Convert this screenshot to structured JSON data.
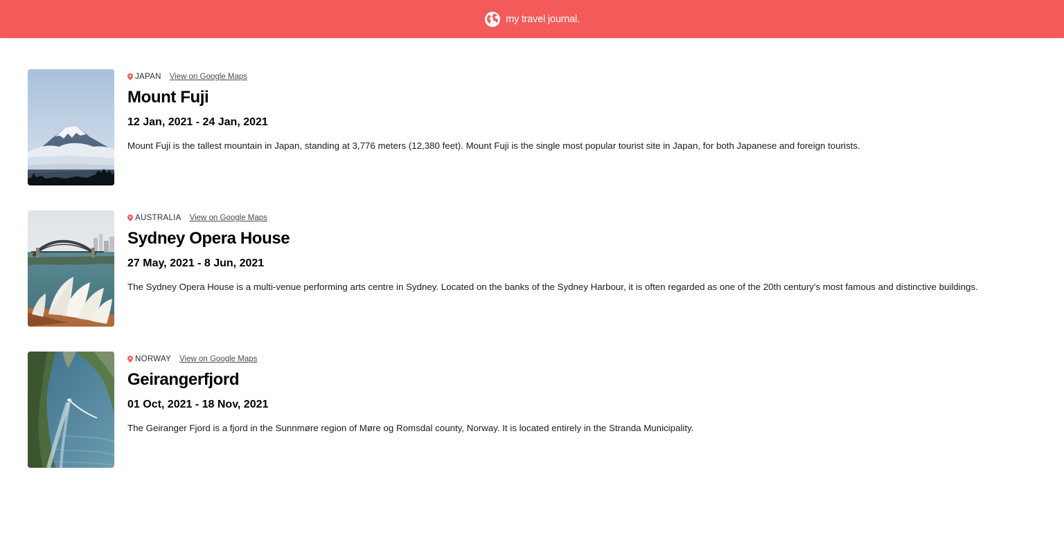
{
  "header": {
    "icon": "globe-icon",
    "title": "my travel journal.",
    "background": "#F55A5A"
  },
  "entries": [
    {
      "country": "JAPAN",
      "maps_link": "View on Google Maps",
      "title": "Mount Fuji",
      "dates": "12 Jan, 2021 - 24 Jan, 2021",
      "description": "Mount Fuji is the tallest mountain in Japan, standing at 3,776 meters (12,380 feet). Mount Fuji is the single most popular tourist site in Japan, for both Japanese and foreign tourists."
    },
    {
      "country": "AUSTRALIA",
      "maps_link": "View on Google Maps",
      "title": "Sydney Opera House",
      "dates": "27 May, 2021 - 8 Jun, 2021",
      "description": "The Sydney Opera House is a multi-venue performing arts centre in Sydney. Located on the banks of the Sydney Harbour, it is often regarded as one of the 20th century's most famous and distinctive buildings."
    },
    {
      "country": "NORWAY",
      "maps_link": "View on Google Maps",
      "title": "Geirangerfjord",
      "dates": "01 Oct, 2021 - 18 Nov, 2021",
      "description": "The Geiranger Fjord is a fjord in the Sunnmøre region of Møre og Romsdal county, Norway. It is located entirely in the Stranda Municipality."
    }
  ],
  "icons": {
    "location": "location-pin-icon",
    "accent": "#F55A5A"
  }
}
